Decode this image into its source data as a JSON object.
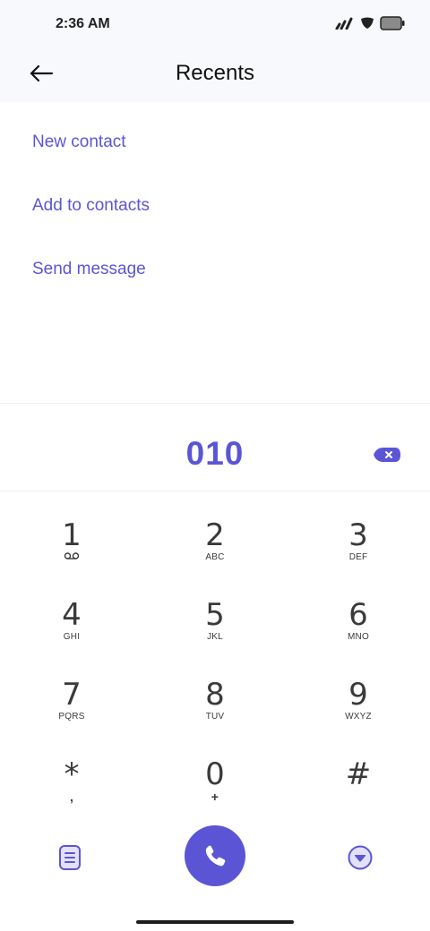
{
  "status_bar": {
    "time": "2:36 AM",
    "icons": [
      "signal-icon",
      "shield-icon",
      "battery-icon"
    ]
  },
  "header": {
    "title": "Recents",
    "back_icon": "arrow-left-icon"
  },
  "actions": [
    {
      "label": "New contact"
    },
    {
      "label": "Add to contacts"
    },
    {
      "label": "Send message"
    }
  ],
  "dialer": {
    "number": "010",
    "backspace_icon": "backspace-icon"
  },
  "keypad": [
    {
      "digit": "1",
      "letters": ""
    },
    {
      "digit": "2",
      "letters": "ABC"
    },
    {
      "digit": "3",
      "letters": "DEF"
    },
    {
      "digit": "4",
      "letters": "GHI"
    },
    {
      "digit": "5",
      "letters": "JKL"
    },
    {
      "digit": "6",
      "letters": "MNO"
    },
    {
      "digit": "7",
      "letters": "PQRS"
    },
    {
      "digit": "8",
      "letters": "TUV"
    },
    {
      "digit": "9",
      "letters": "WXYZ"
    },
    {
      "digit": "*",
      "letters": ","
    },
    {
      "digit": "0",
      "letters": "+"
    },
    {
      "digit": "#",
      "letters": ""
    }
  ],
  "bottom_bar": {
    "left_icon": "notes-icon",
    "call_icon": "phone-icon",
    "right_icon": "collapse-icon"
  },
  "colors": {
    "accent": "#5b55d6",
    "header_bg": "#f8f9fc",
    "key_text": "#3a3a3a"
  }
}
